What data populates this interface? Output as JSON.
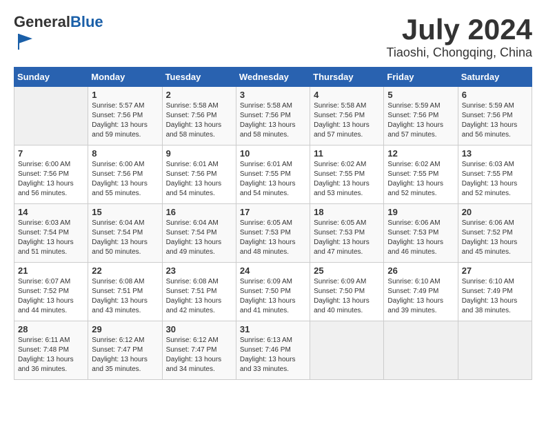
{
  "header": {
    "logo_general": "General",
    "logo_blue": "Blue",
    "month_title": "July 2024",
    "location": "Tiaoshi, Chongqing, China"
  },
  "weekdays": [
    "Sunday",
    "Monday",
    "Tuesday",
    "Wednesday",
    "Thursday",
    "Friday",
    "Saturday"
  ],
  "weeks": [
    [
      {
        "day": "",
        "empty": true
      },
      {
        "day": "1",
        "sunrise": "5:57 AM",
        "sunset": "7:56 PM",
        "daylight": "13 hours and 59 minutes."
      },
      {
        "day": "2",
        "sunrise": "5:58 AM",
        "sunset": "7:56 PM",
        "daylight": "13 hours and 58 minutes."
      },
      {
        "day": "3",
        "sunrise": "5:58 AM",
        "sunset": "7:56 PM",
        "daylight": "13 hours and 58 minutes."
      },
      {
        "day": "4",
        "sunrise": "5:58 AM",
        "sunset": "7:56 PM",
        "daylight": "13 hours and 57 minutes."
      },
      {
        "day": "5",
        "sunrise": "5:59 AM",
        "sunset": "7:56 PM",
        "daylight": "13 hours and 57 minutes."
      },
      {
        "day": "6",
        "sunrise": "5:59 AM",
        "sunset": "7:56 PM",
        "daylight": "13 hours and 56 minutes."
      }
    ],
    [
      {
        "day": "7",
        "sunrise": "6:00 AM",
        "sunset": "7:56 PM",
        "daylight": "13 hours and 56 minutes."
      },
      {
        "day": "8",
        "sunrise": "6:00 AM",
        "sunset": "7:56 PM",
        "daylight": "13 hours and 55 minutes."
      },
      {
        "day": "9",
        "sunrise": "6:01 AM",
        "sunset": "7:56 PM",
        "daylight": "13 hours and 54 minutes."
      },
      {
        "day": "10",
        "sunrise": "6:01 AM",
        "sunset": "7:55 PM",
        "daylight": "13 hours and 54 minutes."
      },
      {
        "day": "11",
        "sunrise": "6:02 AM",
        "sunset": "7:55 PM",
        "daylight": "13 hours and 53 minutes."
      },
      {
        "day": "12",
        "sunrise": "6:02 AM",
        "sunset": "7:55 PM",
        "daylight": "13 hours and 52 minutes."
      },
      {
        "day": "13",
        "sunrise": "6:03 AM",
        "sunset": "7:55 PM",
        "daylight": "13 hours and 52 minutes."
      }
    ],
    [
      {
        "day": "14",
        "sunrise": "6:03 AM",
        "sunset": "7:54 PM",
        "daylight": "13 hours and 51 minutes."
      },
      {
        "day": "15",
        "sunrise": "6:04 AM",
        "sunset": "7:54 PM",
        "daylight": "13 hours and 50 minutes."
      },
      {
        "day": "16",
        "sunrise": "6:04 AM",
        "sunset": "7:54 PM",
        "daylight": "13 hours and 49 minutes."
      },
      {
        "day": "17",
        "sunrise": "6:05 AM",
        "sunset": "7:53 PM",
        "daylight": "13 hours and 48 minutes."
      },
      {
        "day": "18",
        "sunrise": "6:05 AM",
        "sunset": "7:53 PM",
        "daylight": "13 hours and 47 minutes."
      },
      {
        "day": "19",
        "sunrise": "6:06 AM",
        "sunset": "7:53 PM",
        "daylight": "13 hours and 46 minutes."
      },
      {
        "day": "20",
        "sunrise": "6:06 AM",
        "sunset": "7:52 PM",
        "daylight": "13 hours and 45 minutes."
      }
    ],
    [
      {
        "day": "21",
        "sunrise": "6:07 AM",
        "sunset": "7:52 PM",
        "daylight": "13 hours and 44 minutes."
      },
      {
        "day": "22",
        "sunrise": "6:08 AM",
        "sunset": "7:51 PM",
        "daylight": "13 hours and 43 minutes."
      },
      {
        "day": "23",
        "sunrise": "6:08 AM",
        "sunset": "7:51 PM",
        "daylight": "13 hours and 42 minutes."
      },
      {
        "day": "24",
        "sunrise": "6:09 AM",
        "sunset": "7:50 PM",
        "daylight": "13 hours and 41 minutes."
      },
      {
        "day": "25",
        "sunrise": "6:09 AM",
        "sunset": "7:50 PM",
        "daylight": "13 hours and 40 minutes."
      },
      {
        "day": "26",
        "sunrise": "6:10 AM",
        "sunset": "7:49 PM",
        "daylight": "13 hours and 39 minutes."
      },
      {
        "day": "27",
        "sunrise": "6:10 AM",
        "sunset": "7:49 PM",
        "daylight": "13 hours and 38 minutes."
      }
    ],
    [
      {
        "day": "28",
        "sunrise": "6:11 AM",
        "sunset": "7:48 PM",
        "daylight": "13 hours and 36 minutes."
      },
      {
        "day": "29",
        "sunrise": "6:12 AM",
        "sunset": "7:47 PM",
        "daylight": "13 hours and 35 minutes."
      },
      {
        "day": "30",
        "sunrise": "6:12 AM",
        "sunset": "7:47 PM",
        "daylight": "13 hours and 34 minutes."
      },
      {
        "day": "31",
        "sunrise": "6:13 AM",
        "sunset": "7:46 PM",
        "daylight": "13 hours and 33 minutes."
      },
      {
        "day": "",
        "empty": true
      },
      {
        "day": "",
        "empty": true
      },
      {
        "day": "",
        "empty": true
      }
    ]
  ],
  "labels": {
    "sunrise": "Sunrise:",
    "sunset": "Sunset:",
    "daylight": "Daylight:"
  }
}
